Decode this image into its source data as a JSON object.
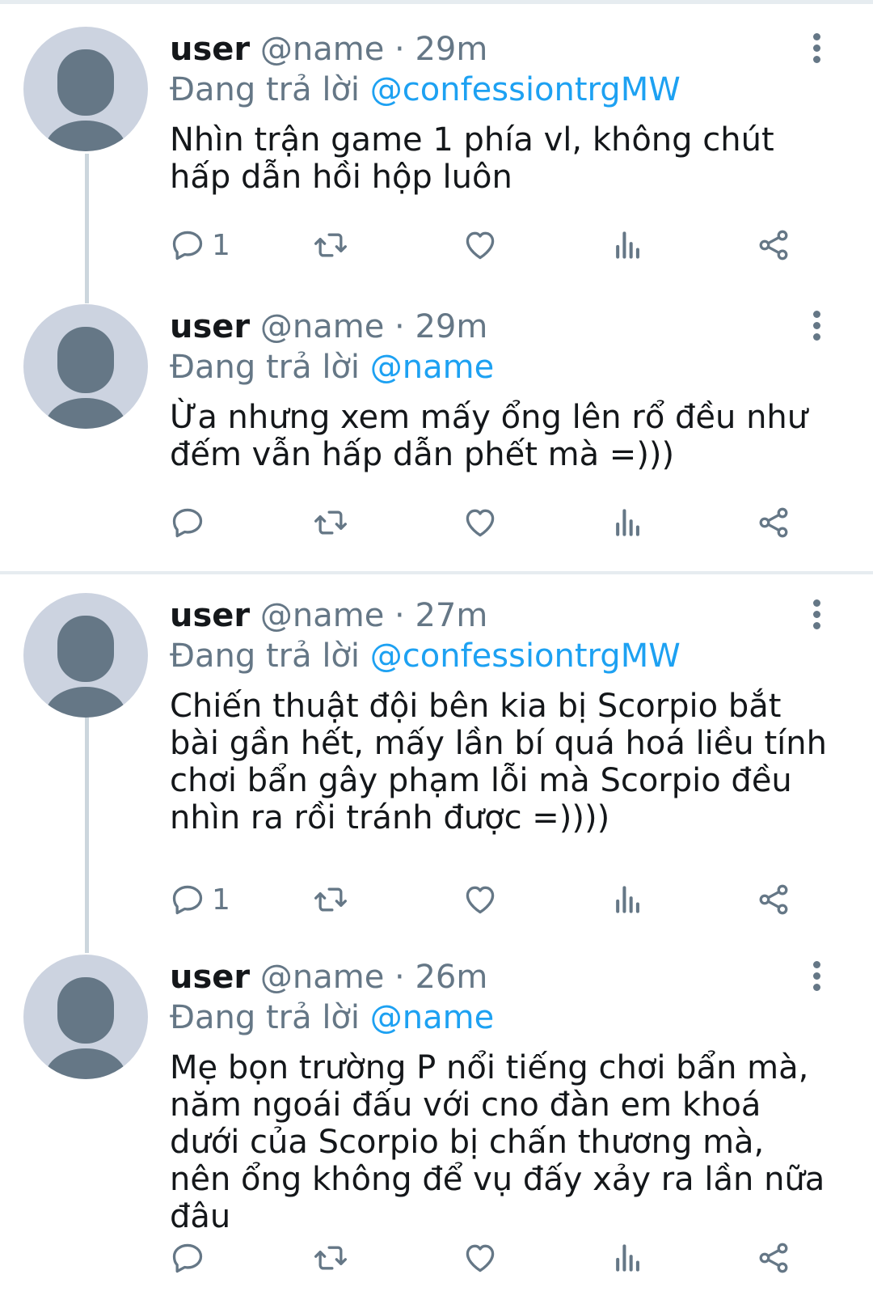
{
  "colors": {
    "text_primary": "#14171a",
    "text_secondary": "#657786",
    "link": "#1da1f2",
    "avatar_bg": "#ccd3e0",
    "divider": "#e6ecf0"
  },
  "replying_prefix": "Đang trả lời",
  "tweets": [
    {
      "username": "user",
      "handle": "@name",
      "dot": "·",
      "time": "29m",
      "reply_to": "@confessiontrgMW",
      "text": "Nhìn trận game 1 phía vl, không chút hấp dẫn hồi hộp luôn",
      "reply_count": "1",
      "icons": [
        "reply-icon",
        "retweet-icon",
        "like-icon",
        "analytics-icon",
        "share-icon",
        "more-icon"
      ]
    },
    {
      "username": "user",
      "handle": "@name",
      "dot": "·",
      "time": "29m",
      "reply_to": "@name",
      "text": "Ừa nhưng xem mấy ổng lên rổ đều như đếm vẫn hấp dẫn phết mà =)))",
      "reply_count": "",
      "icons": [
        "reply-icon",
        "retweet-icon",
        "like-icon",
        "analytics-icon",
        "share-icon",
        "more-icon"
      ]
    },
    {
      "username": "user",
      "handle": "@name",
      "dot": "·",
      "time": "27m",
      "reply_to": "@confessiontrgMW",
      "text": "Chiến thuật đội bên kia bị Scorpio bắt bài gần hết, mấy lần bí quá hoá liều tính chơi bẩn gây phạm lỗi mà Scorpio đều nhìn ra rồi tránh được =))))",
      "reply_count": "1",
      "icons": [
        "reply-icon",
        "retweet-icon",
        "like-icon",
        "analytics-icon",
        "share-icon",
        "more-icon"
      ]
    },
    {
      "username": "user",
      "handle": "@name",
      "dot": "·",
      "time": "26m",
      "reply_to": "@name",
      "text": "Mẹ bọn trường P nổi tiếng chơi bẩn mà, năm ngoái đấu với cno đàn em khoá dưới của Scorpio bị chấn thương mà, nên ổng không để vụ đấy xảy ra lần nữa đâu",
      "reply_count": "",
      "icons": [
        "reply-icon",
        "retweet-icon",
        "like-icon",
        "analytics-icon",
        "share-icon",
        "more-icon"
      ]
    }
  ]
}
